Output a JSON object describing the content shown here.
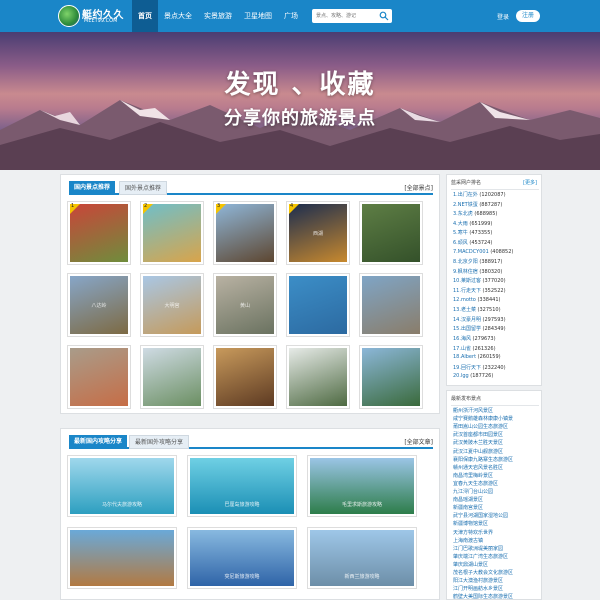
{
  "header": {
    "logo_text": "艇约久久",
    "logo_sub": "MEET99.COM",
    "nav": [
      "首页",
      "景点大全",
      "实景旅游",
      "卫星地图",
      "广场"
    ],
    "search_placeholder": "景点、攻略、游记",
    "login": "登录",
    "register": "注册"
  },
  "banner": {
    "title": "发现 、收藏",
    "subtitle": "分享你的旅游景点"
  },
  "spots_panel": {
    "tab_active": "国内景点推荐",
    "tab_inactive": "国外景点推荐",
    "more": "[全部景点]",
    "items": [
      {
        "badge": "1",
        "label": "",
        "colors": [
          "#c9453a",
          "#6f8d3c"
        ]
      },
      {
        "badge": "2",
        "label": "",
        "colors": [
          "#6fbfc9",
          "#d9a44a"
        ]
      },
      {
        "badge": "3",
        "label": "",
        "colors": [
          "#8fb6d8",
          "#5d4630"
        ]
      },
      {
        "badge": "4",
        "label": "西湖",
        "colors": [
          "#1c2d4f",
          "#c8892e"
        ]
      },
      {
        "badge": "",
        "label": "",
        "colors": [
          "#5e7e45",
          "#34512a"
        ]
      },
      {
        "badge": "",
        "label": "八达岭",
        "colors": [
          "#87a6c8",
          "#7d6a43"
        ]
      },
      {
        "badge": "",
        "label": "大明宫",
        "colors": [
          "#a9c7e5",
          "#c59a5a"
        ]
      },
      {
        "badge": "",
        "label": "黄山",
        "colors": [
          "#b9b2a3",
          "#6a7260"
        ]
      },
      {
        "badge": "",
        "label": "",
        "colors": [
          "#3c8ec7",
          "#2c6aa1"
        ]
      },
      {
        "badge": "",
        "label": "",
        "colors": [
          "#7fa5c6",
          "#8a7d6a"
        ]
      },
      {
        "badge": "",
        "label": "",
        "colors": [
          "#a99c8a",
          "#c66d46"
        ]
      },
      {
        "badge": "",
        "label": "",
        "colors": [
          "#cfdbe4",
          "#6b8f62"
        ]
      },
      {
        "badge": "",
        "label": "",
        "colors": [
          "#c89a5c",
          "#5d3a22"
        ]
      },
      {
        "badge": "",
        "label": "",
        "colors": [
          "#e7ebe8",
          "#4e6a42"
        ]
      },
      {
        "badge": "",
        "label": "",
        "colors": [
          "#8cb7d9",
          "#3a6a3b"
        ]
      }
    ]
  },
  "guides_panel": {
    "tab_active": "最新国内攻略分享",
    "tab_inactive": "最新国外攻略分享",
    "more": "[全部文章]",
    "items": [
      {
        "label": "马尔代夫旅游攻略",
        "colors": [
          "#9fd8ec",
          "#2d9fc0"
        ]
      },
      {
        "label": "巴厘岛旅游攻略",
        "colors": [
          "#6fd0e4",
          "#1b8fb5"
        ]
      },
      {
        "label": "毛里求斯旅游攻略",
        "colors": [
          "#9bc5e6",
          "#2d7d4a"
        ]
      },
      {
        "label": "",
        "colors": [
          "#6aa9d8",
          "#b27a42"
        ]
      },
      {
        "label": "突尼斯旅游攻略",
        "colors": [
          "#88b9e0",
          "#2f64a8"
        ]
      },
      {
        "label": "新西兰旅游攻略",
        "colors": [
          "#9ec7e8",
          "#6d8fa8"
        ]
      }
    ]
  },
  "ranking": {
    "title": "蓝采网户排名",
    "more": "[更多]",
    "items": [
      {
        "name": "1.出门在外",
        "count": "(1202087)"
      },
      {
        "name": "2.NET铁蛋",
        "count": "(887287)"
      },
      {
        "name": "3.东北虎",
        "count": "(688985)"
      },
      {
        "name": "4.大雨",
        "count": "(651999)"
      },
      {
        "name": "5.寒牛",
        "count": "(473355)"
      },
      {
        "name": "6.顽风",
        "count": "(453724)"
      },
      {
        "name": "7.MACDCY001",
        "count": "(408852)"
      },
      {
        "name": "8.北京夕阳",
        "count": "(388917)"
      },
      {
        "name": "9.枫林住宿",
        "count": "(380320)"
      },
      {
        "name": "10.莱斯过客",
        "count": "(377020)"
      },
      {
        "name": "11.行走天下",
        "count": "(352522)"
      },
      {
        "name": "12.motto",
        "count": "(338441)"
      },
      {
        "name": "13.老土菜",
        "count": "(327510)"
      },
      {
        "name": "14.汉豪月明",
        "count": "(297593)"
      },
      {
        "name": "15.出国留学",
        "count": "(284349)"
      },
      {
        "name": "16.海风",
        "count": "(279673)"
      },
      {
        "name": "17.山雀",
        "count": "(261326)"
      },
      {
        "name": "18.Albert",
        "count": "(260159)"
      },
      {
        "name": "19.回行天下",
        "count": "(232240)"
      },
      {
        "name": "20.lgg",
        "count": "(187726)"
      }
    ]
  },
  "latest_spots": {
    "title": "最新发布景点",
    "items": [
      "衢州浙汗河风景区",
      "咸宁赛鹅雄森林康康小镇景",
      "莆田嵩山公园生态旅游区",
      "武汉首座都市田园景区",
      "武汉黄陂木兰胜天景区",
      "武汉江夏中山舰旅游区",
      "襄阳保康九路寨生态旅游区",
      "赣州通天岩风景名胜区",
      "南昌湾里梅岭景区",
      "宜春九天生态旅游区",
      "九江浔门台山公园",
      "南昌瑶湖景区",
      "新疆南宫景区",
      "武宁县河湖国家湿地公园",
      "新疆博物馆景区",
      "天津方特欢乐世界",
      "上海南渡古镇",
      "江门巴歌洲堤美丽家园",
      "肇庆端江广湾生态旅游区",
      "肇庆鼎湖山景区",
      "茂名根子大教会文化旅游区",
      "阳江大澳渔村旅游景区",
      "江门开明画舫水乡景区",
      "鹤壁大美国际生态旅游景区"
    ]
  }
}
